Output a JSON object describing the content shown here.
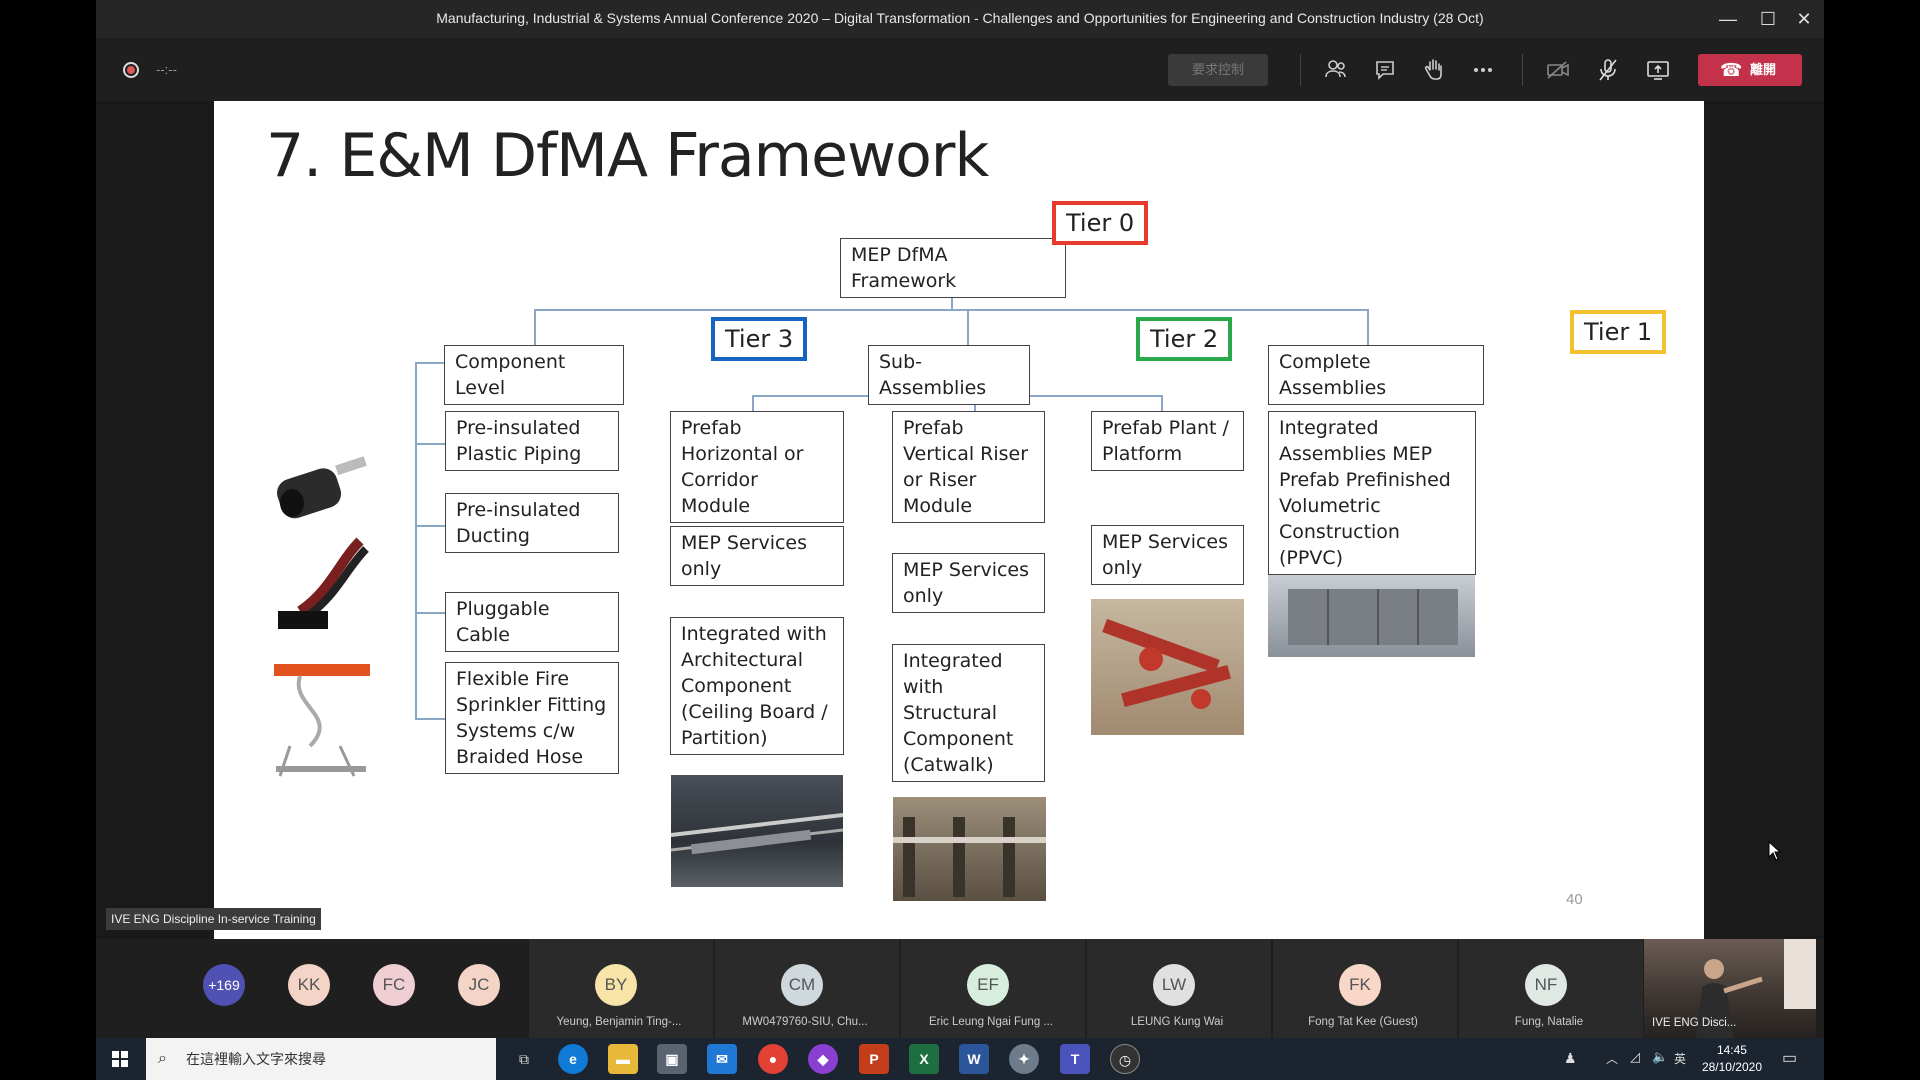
{
  "window": {
    "title": "Manufacturing, Industrial & Systems Annual Conference 2020 – Digital Transformation - Challenges and Opportunities for Engineering and Construction Industry (28 Oct)",
    "minimize": "—",
    "maximize": "☐",
    "close": "✕"
  },
  "toolbar": {
    "timer": "--:--",
    "request_control": "要求控制",
    "hangup_label": "離開"
  },
  "slide": {
    "title": "7. E&M DfMA Framework",
    "page_number": "40",
    "root": "MEP DfMA Framework",
    "tiers": {
      "t0": "Tier 0",
      "t1": "Tier 1",
      "t2": "Tier 2",
      "t3": "Tier 3"
    },
    "categories": {
      "component": "Component Level",
      "sub": "Sub-Assemblies",
      "complete": "Complete Assemblies"
    },
    "component_items": [
      "Pre-insulated Plastic Piping",
      "Pre-insulated Ducting",
      "Pluggable Cable",
      "Flexible Fire Sprinkler Fitting Systems c/w Braided Hose"
    ],
    "sub_col1": [
      "Prefab Horizontal or Corridor Module",
      "MEP Services only",
      "Integrated with Architectural Component (Ceiling Board / Partition)"
    ],
    "sub_col2": [
      "Prefab Vertical Riser or Riser Module",
      "MEP Services only",
      "Integrated with Structural Component (Catwalk)"
    ],
    "sub_col3": [
      "Prefab Plant / Platform",
      "MEP Services only"
    ],
    "complete_items": [
      "Integrated Assemblies MEP Prefab Prefinished Volumetric Construction (PPVC)"
    ],
    "stage_tag": "IVE ENG Discipline In-service Training"
  },
  "participants": {
    "overflow": "+169",
    "initials_only": [
      "KK",
      "FC",
      "JC"
    ],
    "named": [
      {
        "initials": "BY",
        "name": "Yeung, Benjamin Ting-..."
      },
      {
        "initials": "CM",
        "name": "MW0479760-SIU, Chu..."
      },
      {
        "initials": "EF",
        "name": "Eric Leung Ngai Fung ..."
      },
      {
        "initials": "LW",
        "name": "LEUNG Kung Wai"
      },
      {
        "initials": "FK",
        "name": "Fong Tat Kee (Guest)"
      },
      {
        "initials": "NF",
        "name": "Fung, Natalie"
      }
    ],
    "video_name": "IVE ENG Disci..."
  },
  "taskbar": {
    "search_placeholder": "在這裡輸入文字來搜尋",
    "time": "14:45",
    "date": "28/10/2020",
    "ime": "英"
  },
  "colors": {
    "tier0": "#e53b2c",
    "tier1": "#f2c12e",
    "tier2": "#2ba84a",
    "tier3": "#1565c0",
    "hangup": "#c4314b"
  }
}
